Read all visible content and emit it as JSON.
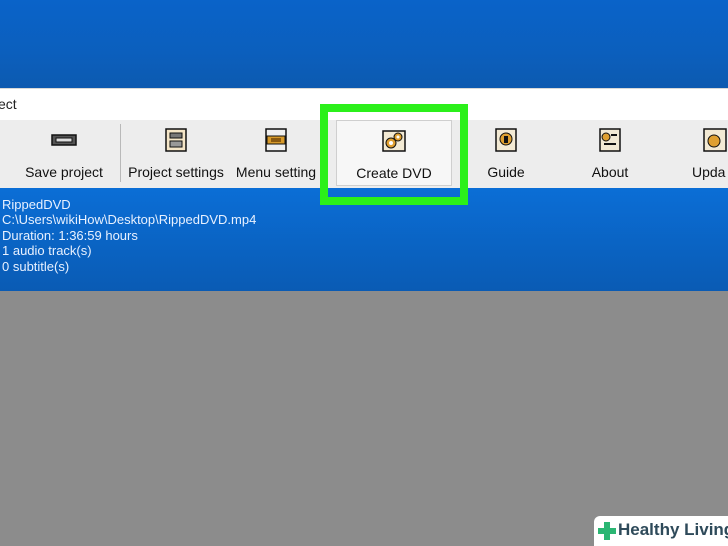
{
  "window": {
    "title_partial": "ect"
  },
  "toolbar": {
    "buttons": [
      {
        "label": "Save project",
        "icon": "dvd-drive-icon"
      },
      {
        "label": "Project settings",
        "icon": "project-settings-icon"
      },
      {
        "label": "Menu setting",
        "icon": "menu-settings-icon"
      },
      {
        "label": "Create DVD",
        "icon": "create-dvd-gears-icon"
      },
      {
        "label": "Guide",
        "icon": "guide-book-icon"
      },
      {
        "label": "About",
        "icon": "about-icon"
      },
      {
        "label": "Upda",
        "icon": "update-icon"
      }
    ]
  },
  "project_info": {
    "name": "RippedDVD",
    "path": "C:\\Users\\wikiHow\\Desktop\\RippedDVD.mp4",
    "duration": "Duration: 1:36:59 hours",
    "audio": "1 audio track(s)",
    "subtitles": "0 subtitle(s)"
  },
  "watermark": {
    "text": "Healthy Living"
  },
  "colors": {
    "desktop_blue": "#0a63c9",
    "info_blue": "#0b6ed6",
    "highlight_green": "#2bf01a",
    "workspace_gray": "#8c8c8c"
  }
}
